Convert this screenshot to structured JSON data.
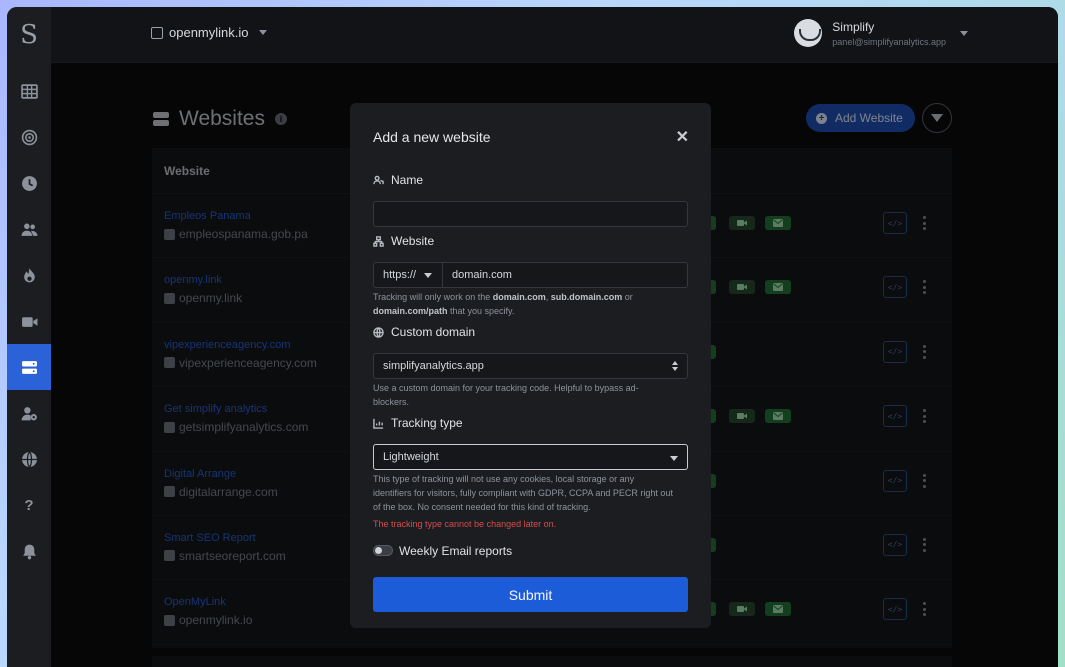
{
  "colors": {
    "accent": "#1c5cd9",
    "sidebar_active": "#2b62d8",
    "success": "#25743a",
    "error": "#d84c4c"
  },
  "sidebar": {
    "logo": "S",
    "items": [
      {
        "icon": "grid-icon"
      },
      {
        "icon": "target-icon"
      },
      {
        "icon": "clock-icon"
      },
      {
        "icon": "users-icon"
      },
      {
        "icon": "fire-icon"
      },
      {
        "icon": "video-icon"
      },
      {
        "icon": "server-icon",
        "active": true
      },
      {
        "icon": "user-settings-icon"
      },
      {
        "icon": "globe-icon"
      },
      {
        "icon": "help-icon"
      },
      {
        "icon": "bell-icon"
      }
    ]
  },
  "topbar": {
    "selected_domain": "openmylink.io",
    "user_name": "Simplify",
    "user_email": "panel@simplifyanalytics.app"
  },
  "page": {
    "title": "Websites",
    "add_button": "Add Website",
    "table_header": "Website"
  },
  "rows": [
    {
      "name": "Empleos Panama",
      "url": "empleospanama.gob.pa"
    },
    {
      "name": "openmy.link",
      "url": "openmy.link"
    },
    {
      "name": "vipexperienceagency.com",
      "url": "vipexperienceagency.com"
    },
    {
      "name": "Get simplify analytics",
      "url": "getsimplifyanalytics.com"
    },
    {
      "name": "Digital Arrange",
      "url": "digitalarrange.com"
    },
    {
      "name": "Smart SEO Report",
      "url": "smartseoreport.com"
    },
    {
      "name": "OpenMyLink",
      "url": "openmylink.io"
    }
  ],
  "modal": {
    "title": "Add a new website",
    "close": "✕",
    "name_label": "Name",
    "name_value": "",
    "website_label": "Website",
    "protocol": "https://",
    "domain_placeholder": "domain.com",
    "website_help_1": "Tracking will only work on the ",
    "website_help_b1": "domain.com",
    "website_help_2": ", ",
    "website_help_b2": "sub.domain.com",
    "website_help_3": " or ",
    "website_help_b3": "domain.com/path",
    "website_help_4": " that you specify.",
    "custom_domain_label": "Custom domain",
    "custom_domain_value": "simplifyanalytics.app",
    "custom_domain_help": "Use a custom domain for your tracking code. Helpful to bypass ad-blockers.",
    "tracking_label": "Tracking type",
    "tracking_value": "Lightweight",
    "tracking_help": "This type of tracking will not use any cookies, local storage or any identifiers for visitors, fully compliant with GDPR, CCPA and PECR right out of the box. No consent needed for this kind of tracking.",
    "tracking_warning": "The tracking type cannot be changed later on.",
    "email_toggle_label": "Weekly Email reports",
    "email_toggle_on": false,
    "submit": "Submit"
  }
}
